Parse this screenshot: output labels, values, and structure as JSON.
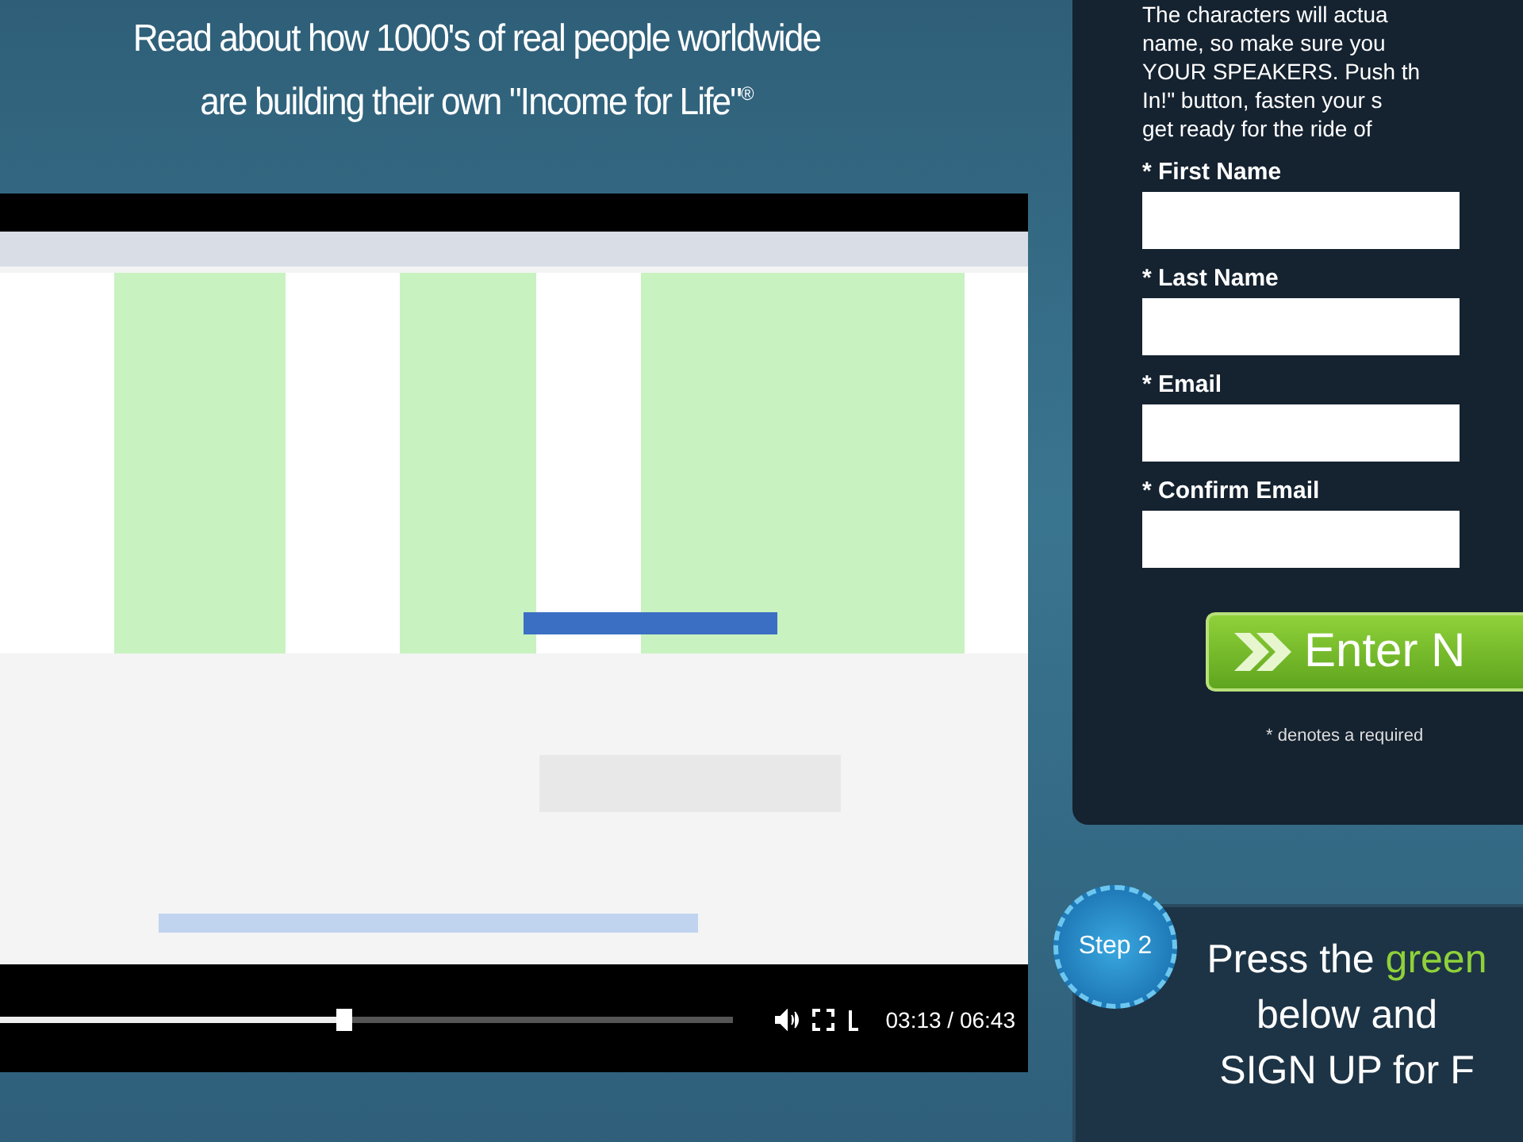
{
  "headline": [
    "Read about how 1000's of real people worldwide",
    "are building their own \"Income for Life\"$^{®}$"
  ],
  "video": {
    "kind": "picture",
    "progress": {
      "level": 0.47
    },
    "time": "03:13 / 06:43"
  },
  "signup_form": {
    "intro_lines": [
      "The characters will actua",
      "name, so make sure you",
      "YOUR SPEAKERS. Push th",
      "In!\" button, fasten your s",
      "get ready for the ride of"
    ],
    "fields": [
      {
        "label": "* First Name"
      },
      {
        "label": "* Last Name"
      },
      {
        "label": "* Email"
      },
      {
        "label": "* Confirm Email"
      }
    ],
    "submit_button": "Enter N",
    "note": "* denotes a required"
  },
  "step2": {
    "badge": "Step 2",
    "lines": [
      "Press the **green**",
      "below and",
      "SIGN UP for F"
    ]
  }
}
